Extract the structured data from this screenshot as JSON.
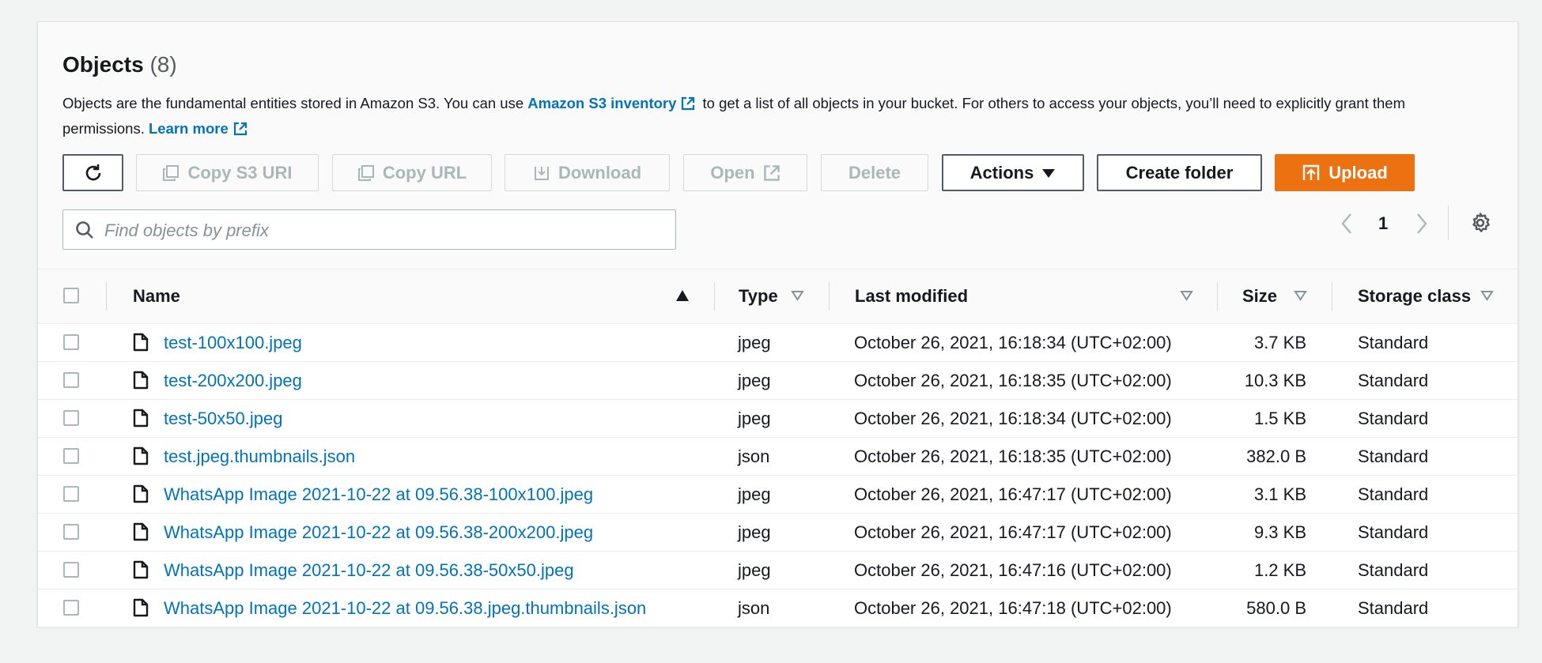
{
  "header": {
    "title": "Objects",
    "count": "(8)",
    "desc_before": "Objects are the fundamental entities stored in Amazon S3. You can use ",
    "desc_link": "Amazon S3 inventory",
    "desc_after": " to get a list of all objects in your bucket. For others to access your objects, you’ll need to explicitly grant them permissions. ",
    "learn_more": "Learn more"
  },
  "toolbar": {
    "copy_s3_uri": "Copy S3 URI",
    "copy_url": "Copy URL",
    "download": "Download",
    "open": "Open",
    "delete": "Delete",
    "actions": "Actions",
    "create_folder": "Create folder",
    "upload": "Upload"
  },
  "search": {
    "placeholder": "Find objects by prefix"
  },
  "pagination": {
    "current_page": "1"
  },
  "table": {
    "columns": [
      "Name",
      "Type",
      "Last modified",
      "Size",
      "Storage class"
    ],
    "rows": [
      {
        "name": "test-100x100.jpeg",
        "type": "jpeg",
        "modified": "October 26, 2021, 16:18:34 (UTC+02:00)",
        "size": "3.7 KB",
        "storage": "Standard"
      },
      {
        "name": "test-200x200.jpeg",
        "type": "jpeg",
        "modified": "October 26, 2021, 16:18:35 (UTC+02:00)",
        "size": "10.3 KB",
        "storage": "Standard"
      },
      {
        "name": "test-50x50.jpeg",
        "type": "jpeg",
        "modified": "October 26, 2021, 16:18:34 (UTC+02:00)",
        "size": "1.5 KB",
        "storage": "Standard"
      },
      {
        "name": "test.jpeg.thumbnails.json",
        "type": "json",
        "modified": "October 26, 2021, 16:18:35 (UTC+02:00)",
        "size": "382.0 B",
        "storage": "Standard"
      },
      {
        "name": "WhatsApp Image 2021-10-22 at 09.56.38-100x100.jpeg",
        "type": "jpeg",
        "modified": "October 26, 2021, 16:47:17 (UTC+02:00)",
        "size": "3.1 KB",
        "storage": "Standard"
      },
      {
        "name": "WhatsApp Image 2021-10-22 at 09.56.38-200x200.jpeg",
        "type": "jpeg",
        "modified": "October 26, 2021, 16:47:17 (UTC+02:00)",
        "size": "9.3 KB",
        "storage": "Standard"
      },
      {
        "name": "WhatsApp Image 2021-10-22 at 09.56.38-50x50.jpeg",
        "type": "jpeg",
        "modified": "October 26, 2021, 16:47:16 (UTC+02:00)",
        "size": "1.2 KB",
        "storage": "Standard"
      },
      {
        "name": "WhatsApp Image 2021-10-22 at 09.56.38.jpeg.thumbnails.json",
        "type": "json",
        "modified": "October 26, 2021, 16:47:18 (UTC+02:00)",
        "size": "580.0 B",
        "storage": "Standard"
      }
    ]
  },
  "colors": {
    "link": "#0073bb",
    "primary": "#ec7211"
  }
}
